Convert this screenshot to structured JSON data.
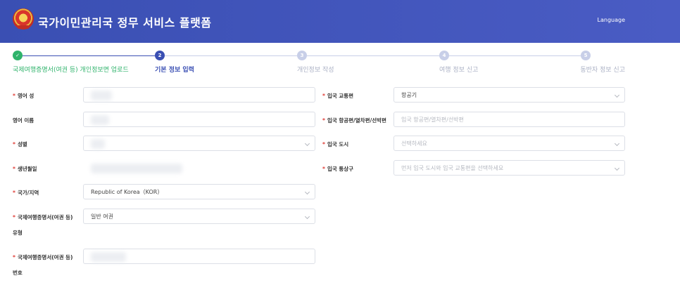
{
  "header": {
    "title": "국가이민관리국 정무 서비스 플랫폼",
    "language": "Language"
  },
  "steps": [
    {
      "label": "국제여행증명서(여권 등) 개인정보면 업로드",
      "num": "✓",
      "state": "done"
    },
    {
      "label": "기본 정보 입력",
      "num": "2",
      "state": "active"
    },
    {
      "label": "개인정보 작성",
      "num": "3",
      "state": "todo"
    },
    {
      "label": "여행 정보 신고",
      "num": "4",
      "state": "todo"
    },
    {
      "label": "동반자 정보 신고",
      "num": "5",
      "state": "todo"
    }
  ],
  "left_form": {
    "surname": {
      "label": "영어 성",
      "required": "*"
    },
    "given_name": {
      "label": "영어 이름"
    },
    "gender": {
      "label": "성별",
      "required": "*"
    },
    "birthdate": {
      "label": "생년월일",
      "required": "*"
    },
    "country": {
      "label": "국가/지역",
      "required": "*",
      "value": "Republic of Korea（KOR）"
    },
    "doc_type": {
      "label_line1": "국제여행증명서(여권 등)",
      "label_line2": "유형",
      "required": "*",
      "value": "일반 여권"
    },
    "doc_number": {
      "label_line1": "국제여행증명서(여권 등)",
      "label_line2": "번호",
      "required": "*"
    }
  },
  "right_form": {
    "transport": {
      "label": "입국 교통편",
      "required": "*",
      "value": "항공기"
    },
    "flight": {
      "label": "입국 항공편/열차편/선박편",
      "required": "*",
      "placeholder": "입국 항공편/열차편/선박편"
    },
    "city": {
      "label": "입국 도시",
      "required": "*",
      "placeholder": "선택하세요"
    },
    "port": {
      "label": "입국 통상구",
      "required": "*",
      "placeholder": "먼저 입국 도시와 입국 교통편을 선택하세요"
    }
  }
}
